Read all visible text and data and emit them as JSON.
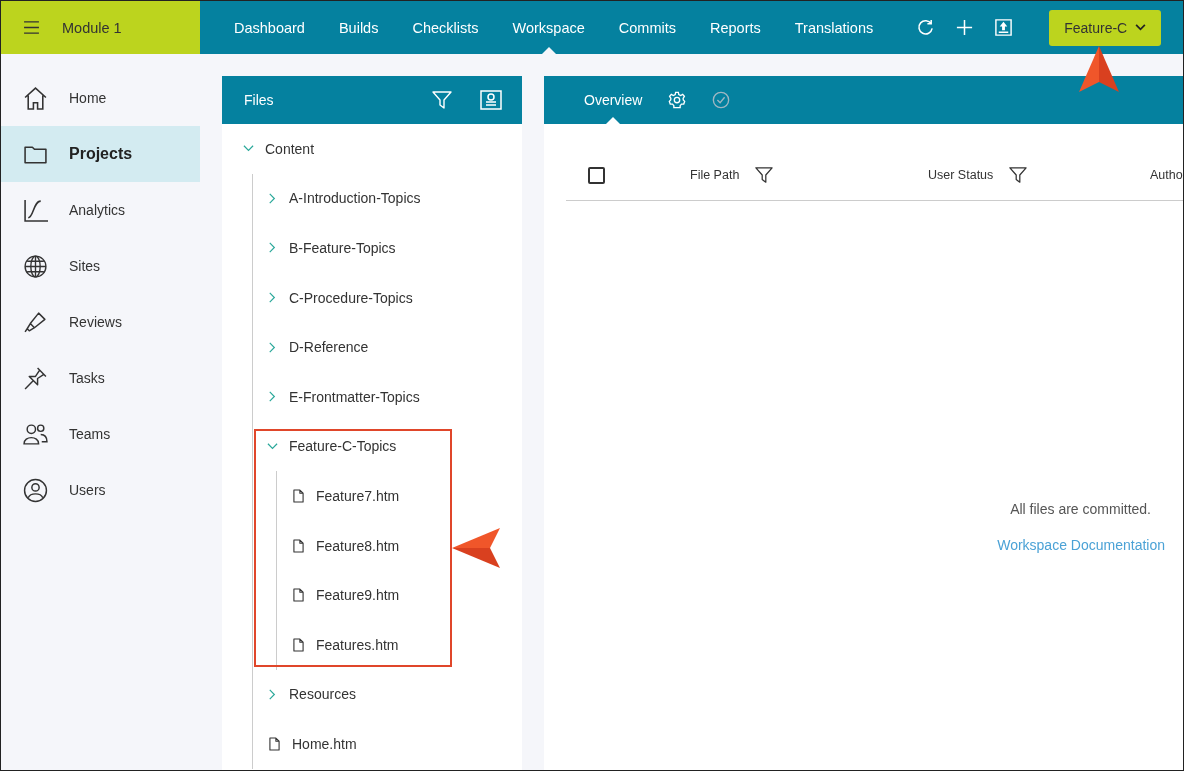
{
  "app": {
    "module": "Module 1"
  },
  "nav": [
    {
      "label": "Dashboard",
      "selected": false
    },
    {
      "label": "Builds",
      "selected": false
    },
    {
      "label": "Checklists",
      "selected": false
    },
    {
      "label": "Workspace",
      "selected": true
    },
    {
      "label": "Commits",
      "selected": false
    },
    {
      "label": "Reports",
      "selected": false
    },
    {
      "label": "Translations",
      "selected": false
    }
  ],
  "branch_button": {
    "label": "Feature-C"
  },
  "sidebar": {
    "items": [
      {
        "label": "Home",
        "selected": false
      },
      {
        "label": "Projects",
        "selected": true
      },
      {
        "label": "Analytics",
        "selected": false
      },
      {
        "label": "Sites",
        "selected": false
      },
      {
        "label": "Reviews",
        "selected": false
      },
      {
        "label": "Tasks",
        "selected": false
      },
      {
        "label": "Teams",
        "selected": false
      },
      {
        "label": "Users",
        "selected": false
      }
    ]
  },
  "files_panel": {
    "title": "Files",
    "tree": [
      {
        "label": "Content",
        "kind": "folder",
        "expanded": true,
        "children": [
          {
            "label": "A-Introduction-Topics",
            "kind": "folder",
            "expanded": false
          },
          {
            "label": "B-Feature-Topics",
            "kind": "folder",
            "expanded": false
          },
          {
            "label": "C-Procedure-Topics",
            "kind": "folder",
            "expanded": false
          },
          {
            "label": "D-Reference",
            "kind": "folder",
            "expanded": false
          },
          {
            "label": "E-Frontmatter-Topics",
            "kind": "folder",
            "expanded": false
          },
          {
            "label": "Feature-C-Topics",
            "kind": "folder",
            "expanded": true,
            "children": [
              {
                "label": "Feature7.htm",
                "kind": "file"
              },
              {
                "label": "Feature8.htm",
                "kind": "file"
              },
              {
                "label": "Feature9.htm",
                "kind": "file"
              },
              {
                "label": "Features.htm",
                "kind": "file"
              }
            ]
          },
          {
            "label": "Resources",
            "kind": "folder",
            "expanded": false
          },
          {
            "label": "Home.htm",
            "kind": "file"
          }
        ]
      }
    ]
  },
  "overview_panel": {
    "tabs": [
      {
        "label": "Overview",
        "selected": true
      }
    ],
    "select_all": {
      "checked": false
    },
    "columns": [
      "File Path",
      "User Status",
      "Autho"
    ],
    "empty_message": "All files are committed.",
    "link": "Workspace Documentation"
  }
}
